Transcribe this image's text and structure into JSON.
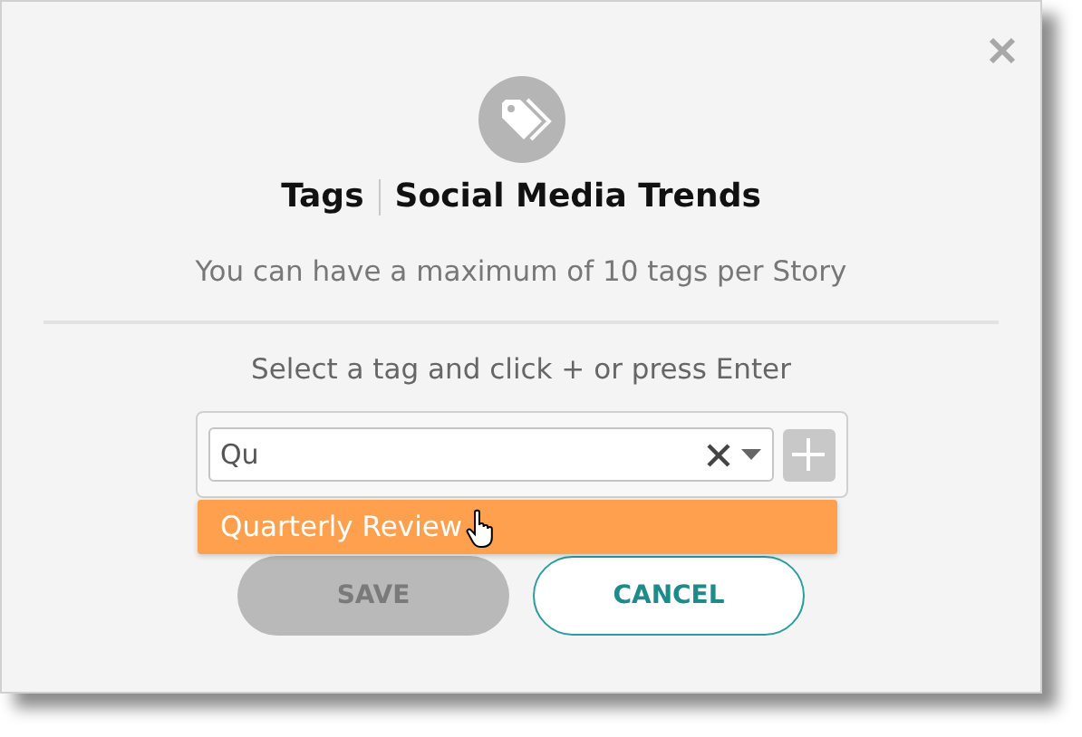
{
  "dialog": {
    "heading": "Tags",
    "story_title": "Social Media Trends",
    "subtitle": "You can have a maximum of 10 tags per Story",
    "instruction": "Select a tag and click + or press Enter"
  },
  "tag_field": {
    "value": "Qu",
    "add_disabled": true
  },
  "suggestions": [
    {
      "label": "Quarterly Review",
      "selected": true
    }
  ],
  "buttons": [
    {
      "kind": "primary",
      "label": "SAVE",
      "disabled": true
    },
    {
      "kind": "secondary",
      "label": "CANCEL",
      "disabled": false
    }
  ]
}
